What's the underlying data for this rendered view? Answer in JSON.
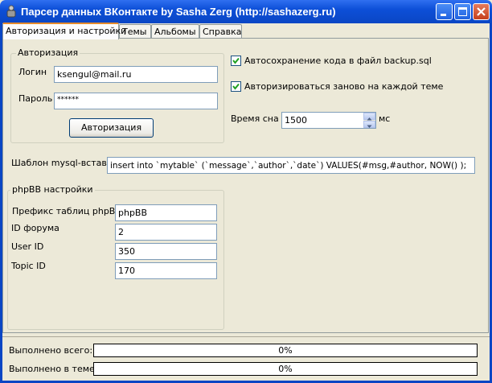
{
  "window": {
    "title": "Парсер данных ВКонтакте  by Sasha Zerg (http://sashazerg.ru)"
  },
  "tabs": [
    {
      "label": "Авторизация и настройки",
      "active": true
    },
    {
      "label": "Темы",
      "active": false
    },
    {
      "label": "Альбомы",
      "active": false
    },
    {
      "label": "Справка",
      "active": false
    }
  ],
  "auth": {
    "group_title": "Авторизация",
    "login_label": "Логин",
    "login_value": "ksengul@mail.ru",
    "password_label": "Пароль",
    "password_value": "******",
    "auth_button": "Авторизация"
  },
  "options": {
    "autosave_label": "Автосохранение кода в файл backup.sql",
    "autosave_checked": true,
    "reauth_label": "Авторизироваться заново на каждой теме",
    "reauth_checked": true,
    "sleep_label": "Время сна",
    "sleep_value": "1500",
    "sleep_unit": "мс"
  },
  "template": {
    "label": "Шаблон mysql-вставки",
    "value": "insert into `mytable` (`message`,`author`,`date`) VALUES(#msg,#author, NOW() );"
  },
  "phpbb": {
    "group_title": "phpBB настройки",
    "prefix_label": "Префикс таблиц phpBB",
    "prefix_value": "phpBB",
    "forum_id_label": "ID форума",
    "forum_id_value": "2",
    "user_id_label": "User ID",
    "user_id_value": "350",
    "topic_id_label": "Topic ID",
    "topic_id_value": "170"
  },
  "status": {
    "total_label": "Выполнено всего:",
    "total_progress": 0,
    "total_text": "0%",
    "topic_label": "Выполнено в теме:",
    "topic_progress": 0,
    "topic_text": "0%"
  },
  "colors": {
    "titlebar": "#0a46c4",
    "tab_highlight": "#e68b2c",
    "progress_fill": "#3a6ea5"
  }
}
